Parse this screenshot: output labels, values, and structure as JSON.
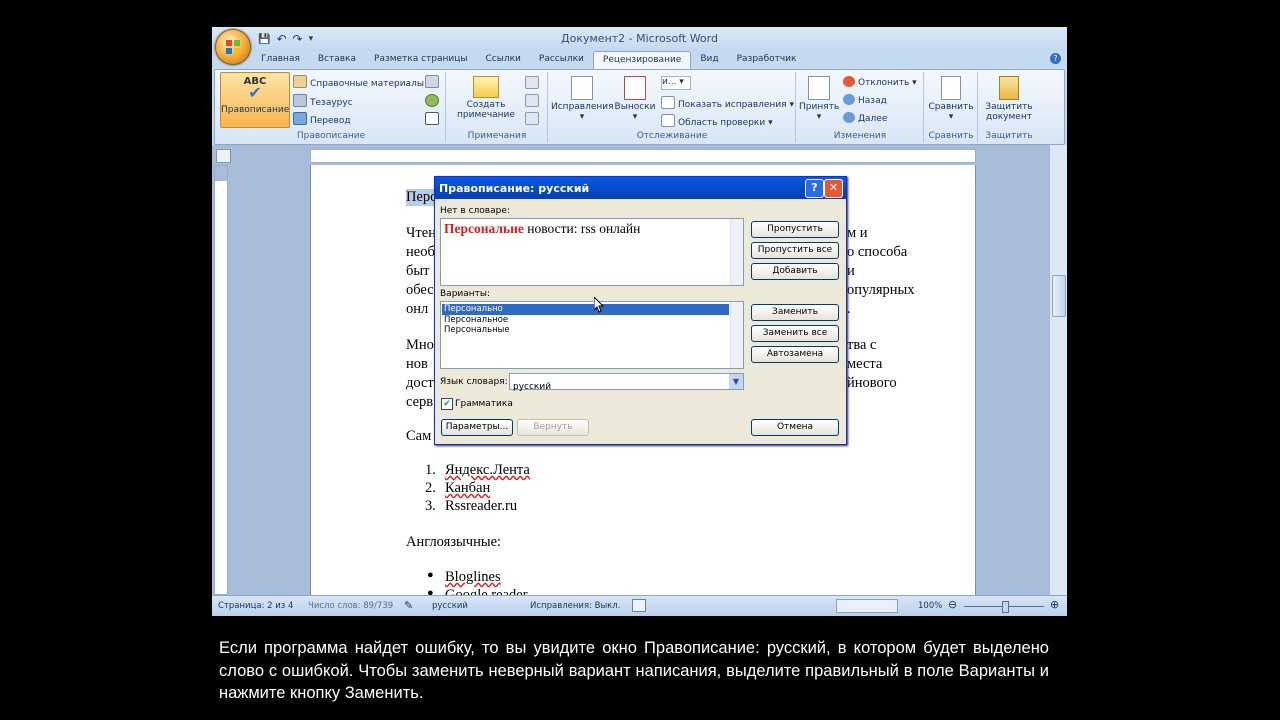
{
  "window": {
    "title": "Документ2 - Microsoft Word",
    "qat": {
      "save": "💾",
      "undo": "↶",
      "redo": "↷",
      "customize": "▾"
    },
    "tabs": [
      "Главная",
      "Вставка",
      "Разметка страницы",
      "Ссылки",
      "Рассылки",
      "Рецензирование",
      "Вид",
      "Разработчик"
    ],
    "active_tab": "Рецензирование"
  },
  "ribbon": {
    "spelling_group": {
      "label": "Правописание",
      "big_button": "Правописание",
      "big_button_icon_text": "ABC",
      "items": [
        "Справочные материалы",
        "Тезаурус",
        "Перевод"
      ]
    },
    "comments_group": {
      "label": "Примечания",
      "create_line1": "Создать",
      "create_line2": "примечание"
    },
    "tracking_group": {
      "label": "Отслеживание",
      "track_changes": "Исправления",
      "balloons": "Выноски",
      "show_markup": "Показать исправления",
      "review_pane": "Область проверки",
      "display_combo": "и..."
    },
    "changes_group": {
      "label": "Изменения",
      "accept": "Принять",
      "reject": "Отклонить",
      "previous": "Назад",
      "next": "Далее"
    },
    "compare_group": {
      "label": "Сравнить",
      "button": "Сравнить"
    },
    "protect_group": {
      "label": "Защитить",
      "line1": "Защитить",
      "line2": "документ"
    }
  },
  "document": {
    "heading_fragment": "Перс",
    "paragraph1_left": [
      "Чтен",
      "необ",
      "быт",
      "обес",
      "онл"
    ],
    "paragraph1_right": [
      "м и",
      "о способа",
      "и",
      "опулярных",
      "."
    ],
    "paragraph2_left": [
      "Мно",
      "нов",
      "дост",
      "серв"
    ],
    "paragraph2_right": [
      "тва с",
      "места",
      "йнового",
      ""
    ],
    "line_sam": "Сам",
    "list_ordered": [
      "Яндекс.Лента",
      "Канбан",
      "Rssreader.ru"
    ],
    "english_heading": "Англоязычные:",
    "list_bullets": [
      "Bloglines",
      "Google reader"
    ]
  },
  "status": {
    "page": "Страница: 2 из 4",
    "words": "Число слов: 89/739",
    "language": "русский",
    "track": "Исправления: Выкл.",
    "zoom": "100%"
  },
  "dialog": {
    "title": "Правописание: русский",
    "help": "?",
    "close": "✕",
    "not_in_dict_label": "Нет в словаре:",
    "error_word": "Персональне",
    "sentence_rest": " новости: rss онлайн",
    "suggestions_label": "Варианты:",
    "suggestions": [
      "Персонально",
      "Персональное",
      "Персональные"
    ],
    "dict_lang_label": "Язык словаря:",
    "dict_lang_value": "русский",
    "grammar_label": "Грамматика",
    "buttons": {
      "ignore": "Пропустить",
      "ignore_all": "Пропустить все",
      "add": "Добавить",
      "change": "Заменить",
      "change_all": "Заменить все",
      "autocorrect": "Автозамена",
      "options": "Параметры...",
      "undo": "Вернуть",
      "cancel": "Отмена"
    }
  },
  "caption": "Если программа найдет ошибку, то вы увидите  окно Правописание:  русский,  в  котором будет выделено слово с ошибкой. Чтобы заменить неверный вариант написания, выделите правильный в поле Варианты и нажмите кнопку Заменить.",
  "colors": {
    "ribbon_bg": "#d8e6f5",
    "dialog_title": "#0a58e5",
    "selection": "#316ac5",
    "error_word": "#d42020"
  }
}
